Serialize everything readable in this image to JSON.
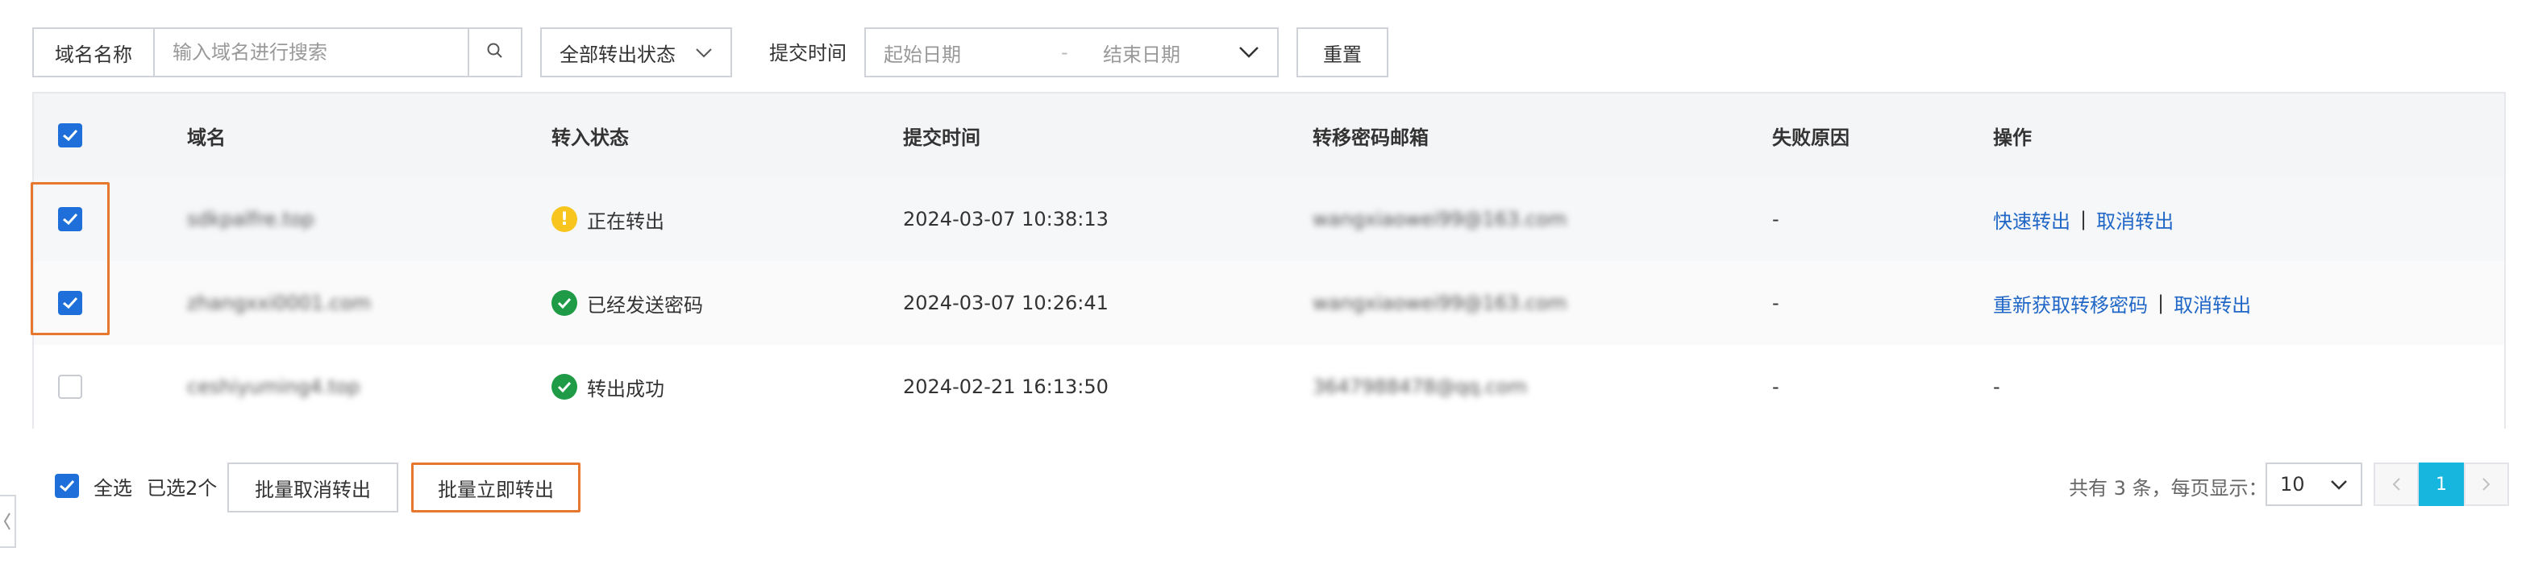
{
  "filters": {
    "domain_label": "域名名称",
    "domain_placeholder": "输入域名进行搜索",
    "status_select": "全部转出状态",
    "time_label": "提交时间",
    "start_date_placeholder": "起始日期",
    "date_separator": "-",
    "end_date_placeholder": "结束日期",
    "reset_label": "重置"
  },
  "table": {
    "headers": {
      "domain": "域名",
      "status": "转入状态",
      "time": "提交时间",
      "email": "转移密码邮箱",
      "reason": "失败原因",
      "ops": "操作"
    },
    "rows": [
      {
        "checked": true,
        "domain": "sdkpalfre.top",
        "status": "正在转出",
        "status_icon": "warning-icon",
        "time": "2024-03-07 10:38:13",
        "email": "wangxiaowei99@163.com",
        "reason": "-",
        "op1": "快速转出",
        "op2": "取消转出"
      },
      {
        "checked": true,
        "domain": "zhangxxi0001.com",
        "status": "已经发送密码",
        "status_icon": "success-icon",
        "time": "2024-03-07 10:26:41",
        "email": "wangxiaowei99@163.com",
        "reason": "-",
        "op1": "重新获取转移密码",
        "op2": "取消转出"
      },
      {
        "checked": false,
        "domain": "ceshiyuming4.top",
        "status": "转出成功",
        "status_icon": "success-icon",
        "time": "2024-02-21 16:13:50",
        "email": "3647988478@qq.com",
        "reason": "-",
        "op_text": "-"
      }
    ]
  },
  "footer": {
    "select_all": "全选",
    "selected_count": "已选2个",
    "batch_cancel": "批量取消转出",
    "batch_transfer": "批量立即转出",
    "total_text": "共有 3 条，每页显示：",
    "page_size": "10",
    "current_page": "1"
  },
  "colors": {
    "accent_blue": "#1e6fd9",
    "link_blue": "#1f66c6",
    "highlight_orange": "#e8772e",
    "pager_active": "#16b6de",
    "warning_yellow": "#f7c51e",
    "success_green": "#1f9b48"
  }
}
